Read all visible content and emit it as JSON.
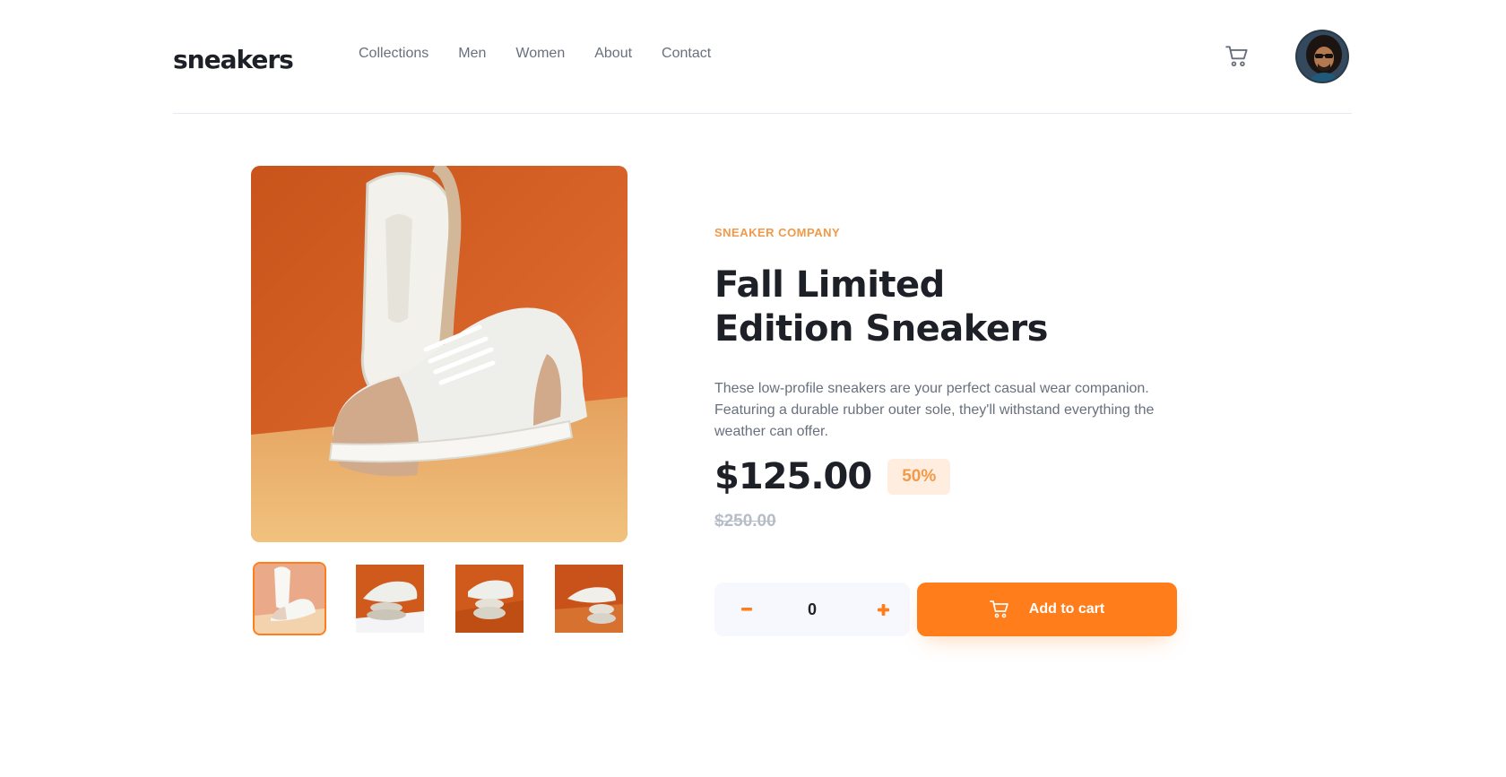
{
  "header": {
    "logo": "sneakers",
    "nav": [
      "Collections",
      "Men",
      "Women",
      "About",
      "Contact"
    ]
  },
  "product": {
    "company": "SNEAKER COMPANY",
    "title": "Fall Limited Edition Sneakers",
    "description": "These low-profile sneakers are your perfect casual wear companion. Featuring a durable rubber outer sole, they'll withstand everything the weather can offer.",
    "price": "$125.00",
    "discount": "50%",
    "original_price": "$250.00",
    "quantity": "0",
    "add_to_cart_label": "Add to cart"
  },
  "colors": {
    "accent": "#ff7e1b",
    "accent_pale": "#ffede0",
    "text_dark": "#1d2026",
    "text_gray": "#69707d"
  },
  "icons": {
    "cart": "cart-icon",
    "minus": "minus-icon",
    "plus": "plus-icon"
  }
}
